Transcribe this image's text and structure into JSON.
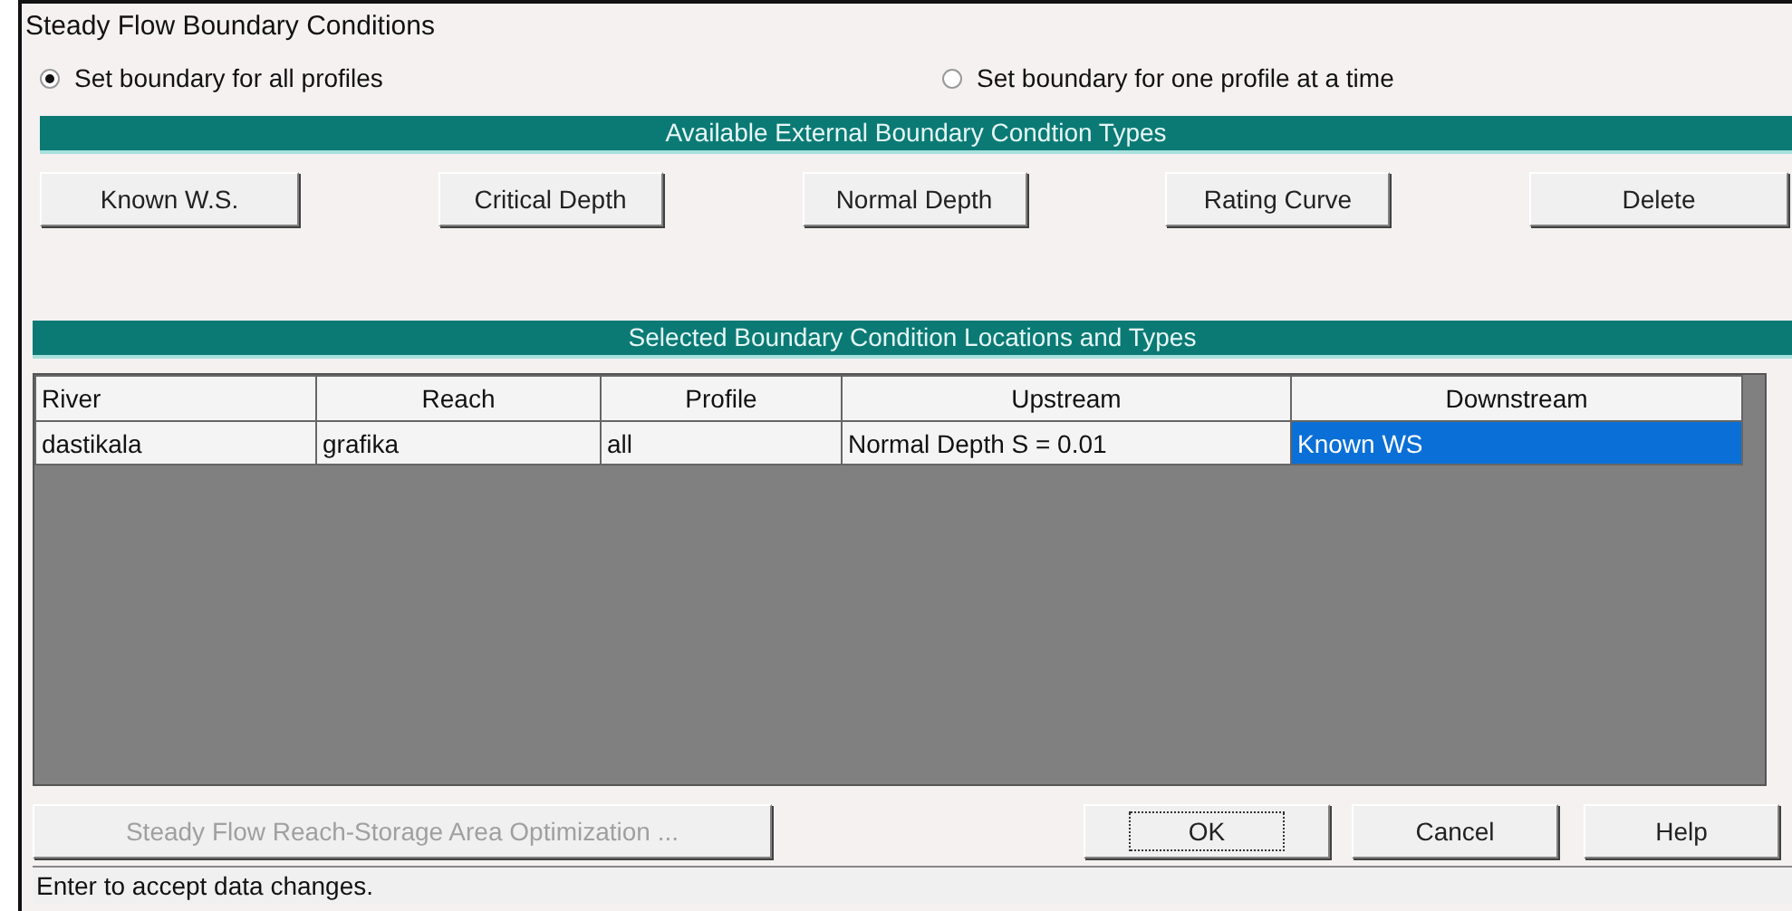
{
  "window": {
    "title": "Steady Flow Boundary Conditions"
  },
  "radios": [
    {
      "label": "Set boundary for all profiles",
      "selected": true
    },
    {
      "label": "Set boundary for one profile at a time",
      "selected": false
    }
  ],
  "types_header": "Available External Boundary Condtion Types",
  "type_buttons": [
    "Known W.S.",
    "Critical Depth",
    "Normal Depth",
    "Rating Curve",
    "Delete"
  ],
  "locations_header": "Selected Boundary Condition Locations and Types",
  "table": {
    "columns": [
      "River",
      "Reach",
      "Profile",
      "Upstream",
      "Downstream"
    ],
    "rows": [
      {
        "cells": [
          {
            "text": "dastikala",
            "selected": false
          },
          {
            "text": "grafika",
            "selected": false
          },
          {
            "text": "all",
            "selected": false
          },
          {
            "text": "Normal Depth S = 0.01",
            "selected": false
          },
          {
            "text": "Known WS",
            "selected": true
          }
        ]
      }
    ]
  },
  "bottom_buttons": [
    {
      "label": "Steady Flow Reach-Storage Area Optimization ...",
      "disabled": true,
      "focused": false
    },
    {
      "label": "OK",
      "disabled": false,
      "focused": true
    },
    {
      "label": "Cancel",
      "disabled": false,
      "focused": false
    },
    {
      "label": "Help",
      "disabled": false,
      "focused": false
    }
  ],
  "status_bar": "Enter to accept data changes."
}
